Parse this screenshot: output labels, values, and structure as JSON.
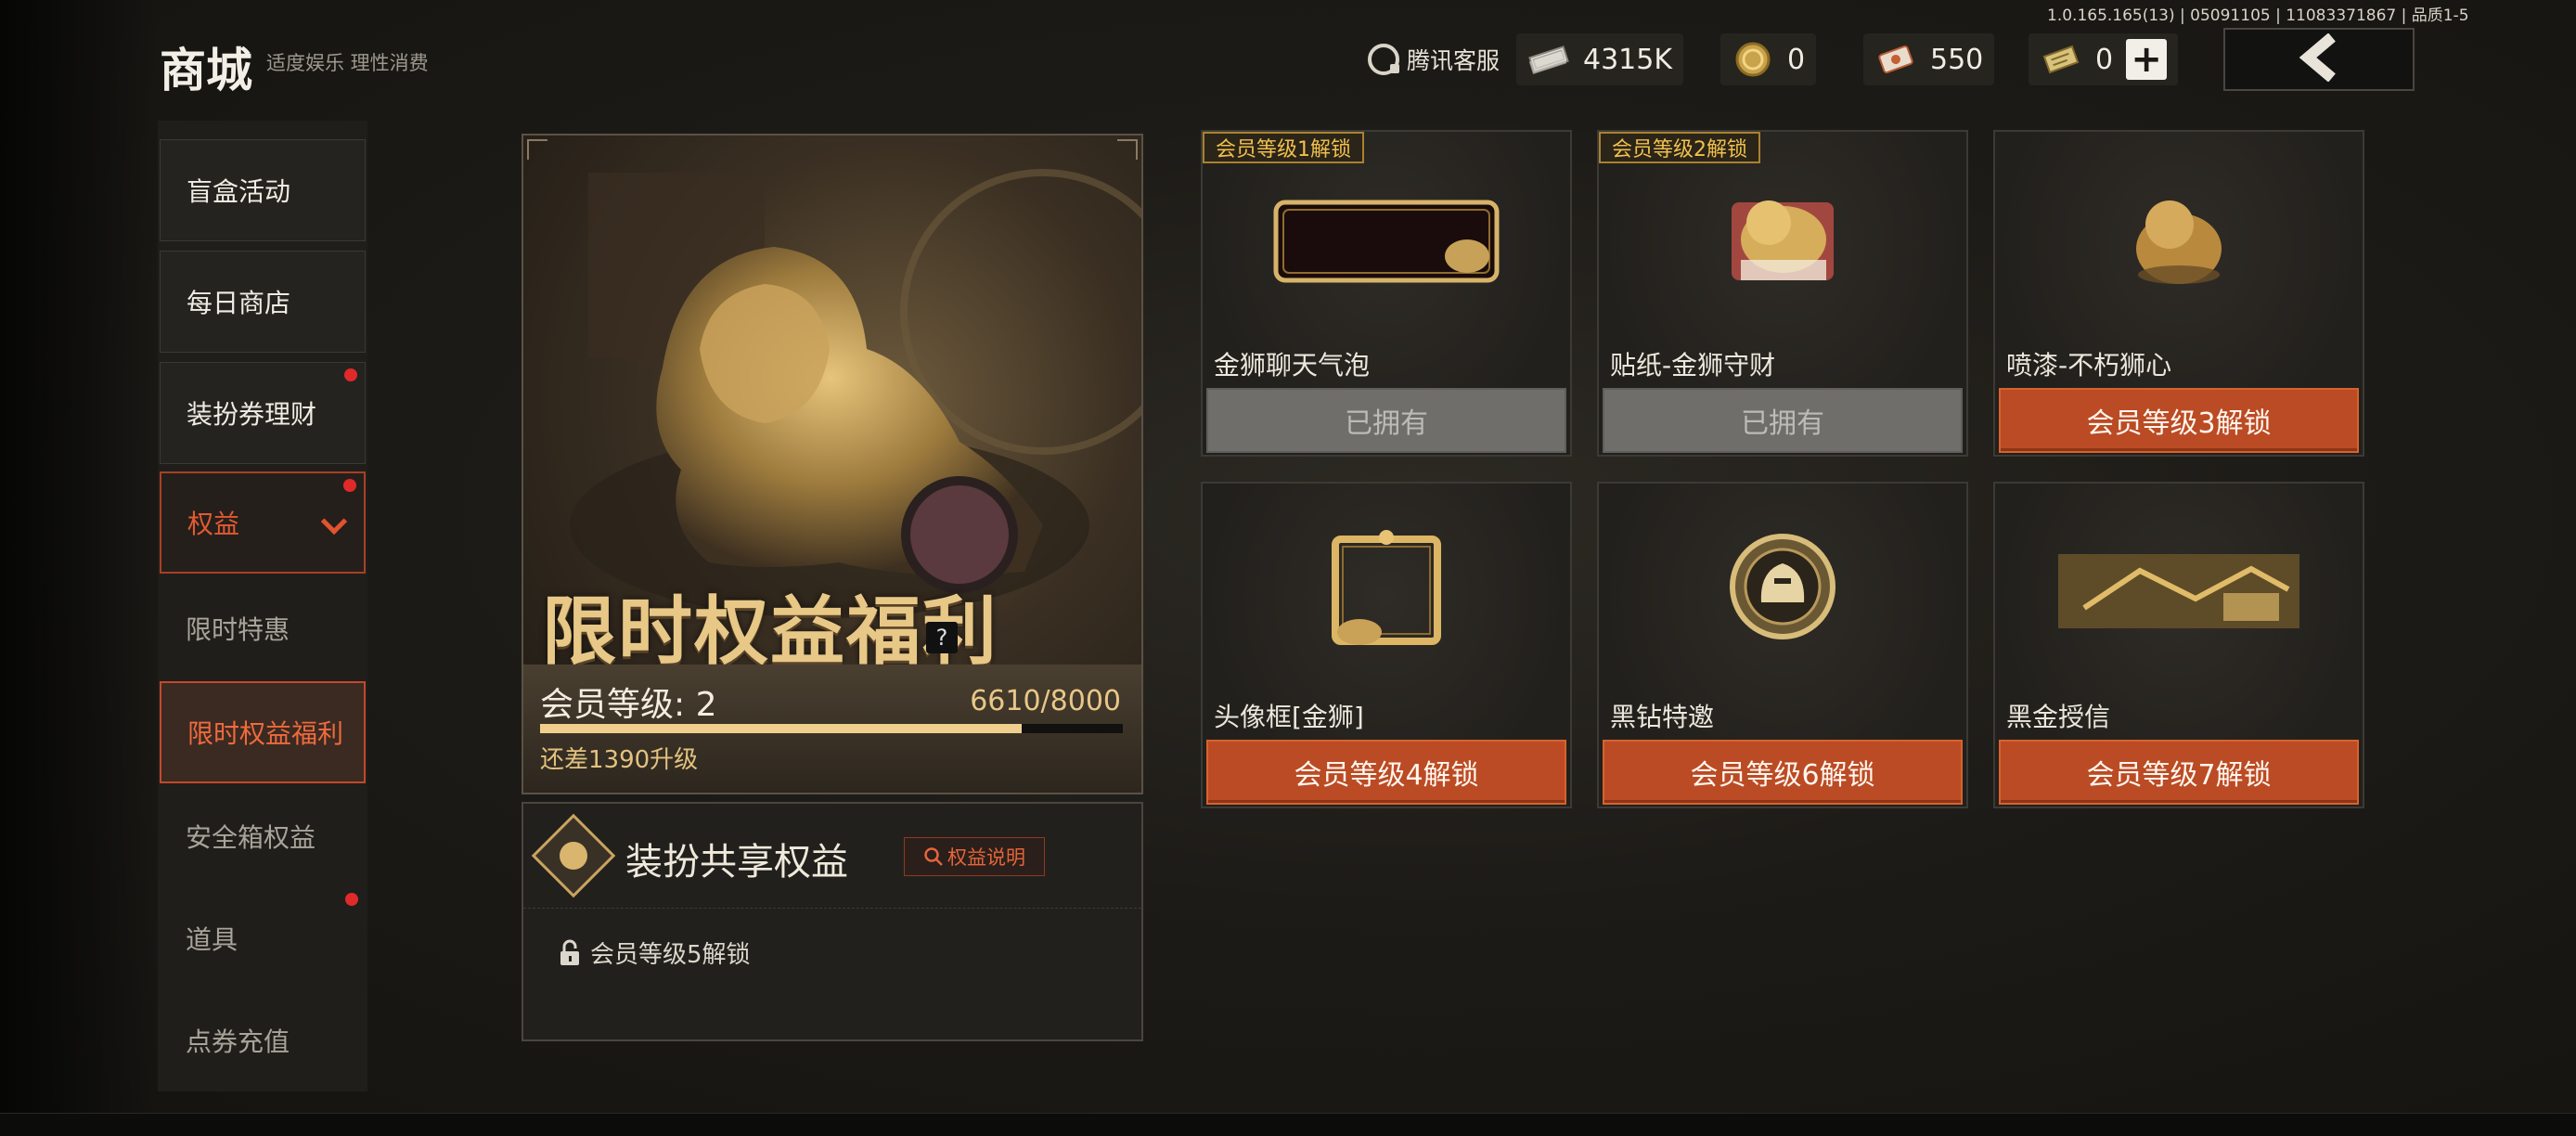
{
  "header": {
    "title": "商城",
    "slogan": "适度娱乐 理性消费",
    "version": "1.0.165.165(13) | 05091105 | 11083371867 | 品质1-5",
    "customer_service": "腾讯客服",
    "currencies": [
      {
        "icon": "cash-stack-icon",
        "value": "4315K"
      },
      {
        "icon": "gold-coin-icon",
        "value": "0"
      },
      {
        "icon": "coupon-ticket-icon",
        "value": "550"
      },
      {
        "icon": "gold-ticket-icon",
        "value": "0"
      }
    ],
    "back_icon": "chevron-left-icon"
  },
  "sidebar": {
    "items": [
      {
        "label": "盲盒活动"
      },
      {
        "label": "每日商店"
      },
      {
        "label": "装扮券理财",
        "dot": true
      },
      {
        "label": "权益",
        "dot": true,
        "expanded": true
      },
      {
        "label": "限时特惠"
      },
      {
        "label": "限时权益福利",
        "active": true
      },
      {
        "label": "安全箱权益"
      },
      {
        "label": "道具",
        "dot": true
      },
      {
        "label": "点券充值"
      }
    ]
  },
  "hero": {
    "title": "限时权益福利",
    "help": "?",
    "level_label": "会员等级: 2",
    "level_progress": "6610/8000",
    "progress_fraction": 0.826,
    "level_gap": "还差1390升级"
  },
  "share": {
    "title": "装扮共享权益",
    "rule_button": "权益说明",
    "lock_text": "会员等级5解锁"
  },
  "items": [
    {
      "badge": "会员等级1解锁",
      "name": "金狮聊天气泡",
      "button": "已拥有",
      "state": "owned",
      "art": "chat-bubble-frame-icon"
    },
    {
      "badge": "会员等级2解锁",
      "name": "贴纸-金狮守财",
      "button": "已拥有",
      "state": "owned",
      "art": "lion-sticker-icon"
    },
    {
      "badge": "",
      "name": "喷漆-不朽狮心",
      "button": "会员等级3解锁",
      "state": "locked",
      "art": "lion-spray-icon"
    },
    {
      "badge": "",
      "name": "头像框[金狮]",
      "button": "会员等级4解锁",
      "state": "locked",
      "art": "avatar-frame-icon"
    },
    {
      "badge": "",
      "name": "黑钻特邀",
      "button": "会员等级6解锁",
      "state": "locked",
      "art": "knight-helmet-badge-icon"
    },
    {
      "badge": "",
      "name": "黑金授信",
      "button": "会员等级7解锁",
      "state": "locked",
      "art": "black-gold-card-icon"
    }
  ]
}
